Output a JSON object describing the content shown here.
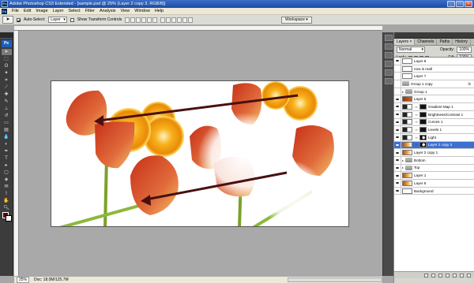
{
  "window": {
    "title": "Adobe Photoshop CS3 Extended - [sample.psd @ 25% (Layer 2 copy 3, RGB/8)]",
    "app_icon": "Ps"
  },
  "menu": [
    "File",
    "Edit",
    "Image",
    "Layer",
    "Select",
    "Filter",
    "Analysis",
    "View",
    "Window",
    "Help"
  ],
  "options": {
    "auto_select_label": "Auto-Select:",
    "auto_select_value": "Layer",
    "show_transform_label": "Show Transform Controls",
    "workspace_label": "Workspace"
  },
  "toolbox": {
    "badge": "Ps"
  },
  "status": {
    "zoom": "25%",
    "doc": "Doc: 18.0M/125.7M"
  },
  "layers_panel": {
    "tabs": [
      "Layers ×",
      "Channels",
      "Paths",
      "History"
    ],
    "blend_mode": "Normal",
    "opacity_label": "Opacity:",
    "opacity_value": "100%",
    "lock_label": "Lock:",
    "fill_label": "Fill:",
    "fill_value": "100%",
    "layers": [
      {
        "name": "Layer 8",
        "visible": true,
        "thumb": "blank"
      },
      {
        "name": "now is reall",
        "visible": false,
        "thumb": "blank"
      },
      {
        "name": "Layer 7",
        "visible": false,
        "thumb": "blank"
      },
      {
        "name": "Group 1 copy",
        "visible": false,
        "thumb": "folder",
        "fx": "fx"
      },
      {
        "name": "Group 1",
        "visible": false,
        "thumb": "folder",
        "triangle": true
      },
      {
        "name": "Layer 5",
        "visible": true,
        "thumb": "orange"
      },
      {
        "name": "Gradient Map 1",
        "visible": true,
        "thumb": "adj",
        "mask": true
      },
      {
        "name": "Brightness/Contrast 1",
        "visible": true,
        "thumb": "adj",
        "mask": true
      },
      {
        "name": "Curves 1",
        "visible": true,
        "thumb": "adj",
        "mask": true
      },
      {
        "name": "Levels 1",
        "visible": true,
        "thumb": "adj",
        "mask": true
      },
      {
        "name": "Light",
        "visible": true,
        "thumb": "adj",
        "mask": true,
        "maskw": true
      },
      {
        "name": "Layer 2 copy 3",
        "visible": true,
        "thumb": "photo",
        "mask": true,
        "maskw": true,
        "selected": true
      },
      {
        "name": "Layer 2 copy 1",
        "visible": true,
        "thumb": "photo"
      },
      {
        "name": "Bottom",
        "visible": true,
        "thumb": "folder",
        "triangle": true
      },
      {
        "name": "Top",
        "visible": true,
        "thumb": "folder",
        "triangle": true
      },
      {
        "name": "Layer 1",
        "visible": true,
        "thumb": "photo"
      },
      {
        "name": "Layer 6",
        "visible": true,
        "thumb": "photo"
      },
      {
        "name": "Background",
        "visible": true,
        "thumb": "blank"
      }
    ]
  },
  "colors": {
    "foreground": "#5a0000",
    "background": "#ffffff",
    "selection": "#3d6fd1"
  }
}
